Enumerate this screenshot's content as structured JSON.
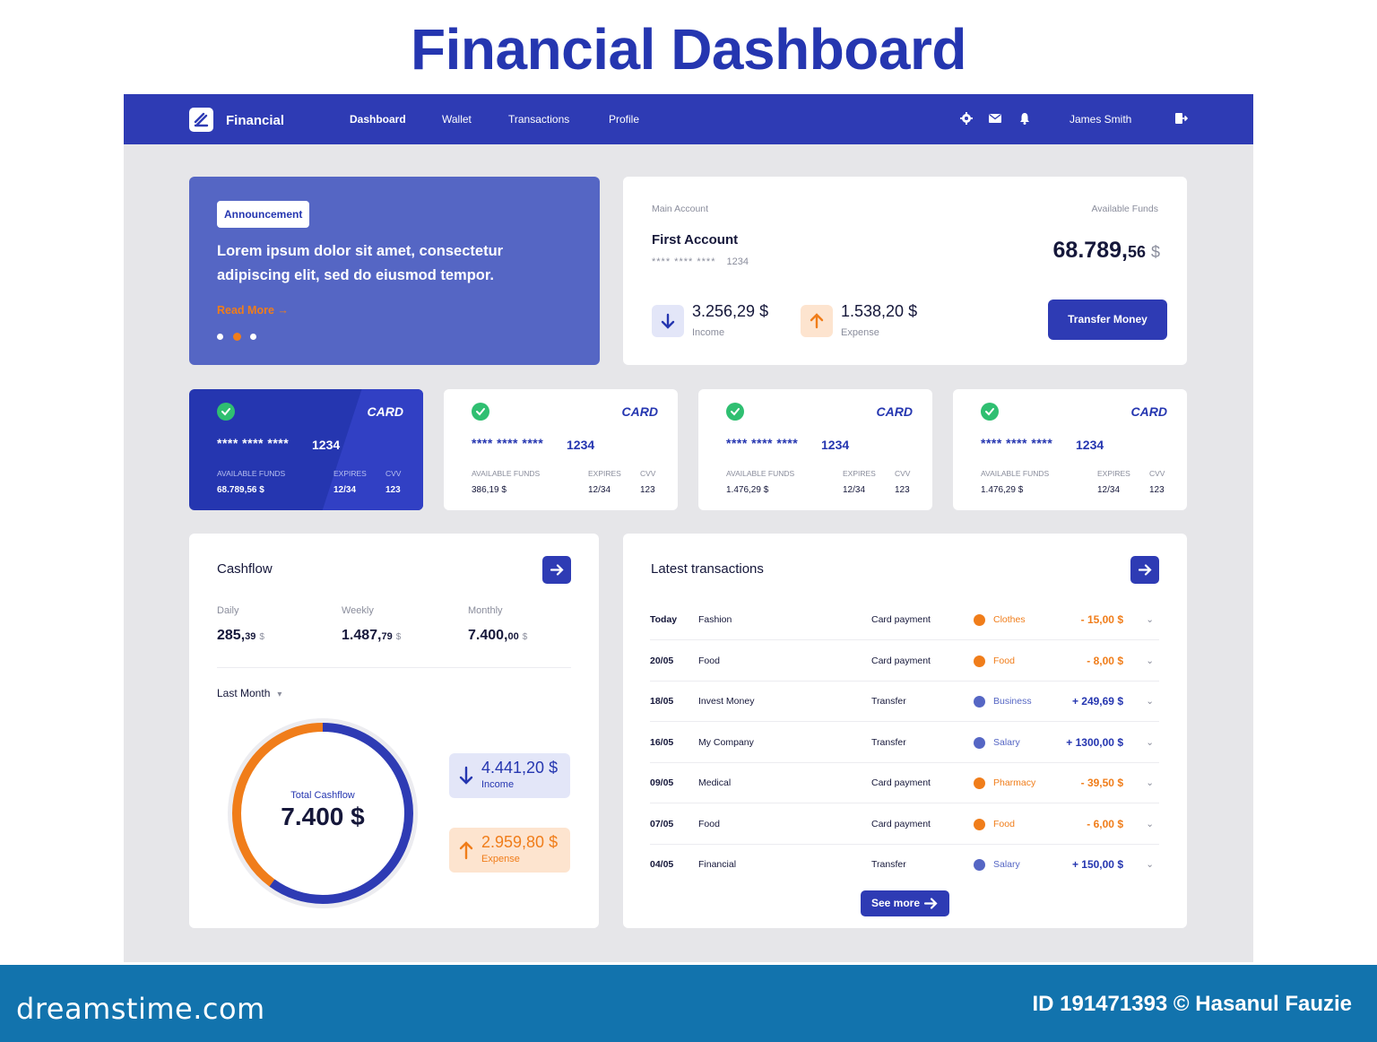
{
  "page_title": "Financial Dashboard",
  "nav": {
    "brand": "Financial",
    "items": [
      {
        "label": "Dashboard"
      },
      {
        "label": "Wallet"
      },
      {
        "label": "Transactions"
      },
      {
        "label": "Profile"
      }
    ],
    "user_name": "James Smith",
    "icons": [
      "gear-icon",
      "mail-icon",
      "bell-icon",
      "logout-icon"
    ]
  },
  "announcement": {
    "badge": "Announcement",
    "text": "Lorem ipsum dolor sit amet, consectetur adipiscing elit, sed do eiusmod tempor.",
    "link": "Read More",
    "active_dot": 2
  },
  "account": {
    "label": "Main Account",
    "name": "First Account",
    "mask": "**** **** ****",
    "last4": "1234",
    "funds_label": "Available Funds",
    "funds_main": "68.789,",
    "funds_cents": "56",
    "funds_currency": "$",
    "income_value": "3.256,29 $",
    "income_label": "Income",
    "expense_value": "1.538,20 $",
    "expense_label": "Expense",
    "transfer_button": "Transfer Money"
  },
  "cards": [
    {
      "brand": "CARD",
      "mask": "**** **** ****",
      "last4": "1234",
      "funds_label": "AVAILABLE FUNDS",
      "funds": "68.789,56 $",
      "expires_label": "EXPIRES",
      "expires": "12/34",
      "cvv_label": "CVV",
      "cvv": "123"
    },
    {
      "brand": "CARD",
      "mask": "**** **** ****",
      "last4": "1234",
      "funds_label": "AVAILABLE FUNDS",
      "funds": "386,19 $",
      "expires_label": "EXPIRES",
      "expires": "12/34",
      "cvv_label": "CVV",
      "cvv": "123"
    },
    {
      "brand": "CARD",
      "mask": "**** **** ****",
      "last4": "1234",
      "funds_label": "AVAILABLE FUNDS",
      "funds": "1.476,29 $",
      "expires_label": "EXPIRES",
      "expires": "12/34",
      "cvv_label": "CVV",
      "cvv": "123"
    },
    {
      "brand": "CARD",
      "mask": "**** **** ****",
      "last4": "1234",
      "funds_label": "AVAILABLE FUNDS",
      "funds": "1.476,29 $",
      "expires_label": "EXPIRES",
      "expires": "12/34",
      "cvv_label": "CVV",
      "cvv": "123"
    }
  ],
  "cashflow": {
    "title": "Cashflow",
    "periods": [
      {
        "label": "Daily",
        "main": "285,",
        "cents": "39",
        "currency": "$"
      },
      {
        "label": "Weekly",
        "main": "1.487,",
        "cents": "79",
        "currency": "$"
      },
      {
        "label": "Monthly",
        "main": "7.400,",
        "cents": "00",
        "currency": "$"
      }
    ],
    "range": "Last Month",
    "total_label": "Total Cashflow",
    "total_value": "7.400 $",
    "income_value": "4.441,20 $",
    "income_label": "Income",
    "expense_value": "2.959,80 $",
    "expense_label": "Expense",
    "income_share": 0.6,
    "expense_share": 0.4
  },
  "transactions": {
    "title": "Latest transactions",
    "see_more": "See more",
    "rows": [
      {
        "date": "Today",
        "name": "Fashion",
        "method": "Card payment",
        "category": "Clothes",
        "kind": "expense",
        "amount": "- 15,00 $"
      },
      {
        "date": "20/05",
        "name": "Food",
        "method": "Card payment",
        "category": "Food",
        "kind": "expense",
        "amount": "- 8,00 $"
      },
      {
        "date": "18/05",
        "name": "Invest Money",
        "method": "Transfer",
        "category": "Business",
        "kind": "income",
        "amount": "+ 249,69 $"
      },
      {
        "date": "16/05",
        "name": "My Company",
        "method": "Transfer",
        "category": "Salary",
        "kind": "income",
        "amount": "+ 1300,00 $"
      },
      {
        "date": "09/05",
        "name": "Medical",
        "method": "Card payment",
        "category": "Pharmacy",
        "kind": "expense",
        "amount": "- 39,50 $"
      },
      {
        "date": "07/05",
        "name": "Food",
        "method": "Card payment",
        "category": "Food",
        "kind": "expense",
        "amount": "- 6,00 $"
      },
      {
        "date": "04/05",
        "name": "Financial",
        "method": "Transfer",
        "category": "Salary",
        "kind": "income",
        "amount": "+ 150,00 $"
      }
    ]
  },
  "colors": {
    "primary": "#2e3bb4",
    "accent_orange": "#f07d1a",
    "income_blue": "#2536b0",
    "success_green": "#2fbf71"
  },
  "footer": {
    "brand": "dreamstime.com",
    "credit": "ID 191471393 © Hasanul Fauzie"
  }
}
